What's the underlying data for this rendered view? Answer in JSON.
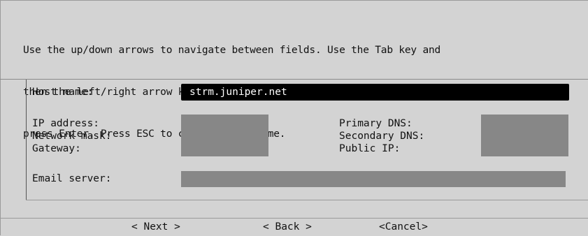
{
  "instructions": [
    "Use the up/down arrows to navigate between fields. Use the Tab key and",
    "then the left/right arrow keys to select Next, back or Cancel, then",
    "press Enter. Press ESC to cancel at anytime."
  ],
  "fields": {
    "host_name_label": "Host name:",
    "host_name_value": "strm.juniper.net",
    "ip_address_label": "IP address:",
    "network_mask_label": "Network mask:",
    "gateway_label": "Gateway:",
    "primary_dns_label": "Primary DNS:",
    "secondary_dns_label": "Secondary DNS:",
    "public_ip_label": "Public IP:",
    "email_server_label": "Email server:"
  },
  "buttons": {
    "next": "< Next >",
    "back": "< Back >",
    "cancel": "<Cancel>"
  }
}
